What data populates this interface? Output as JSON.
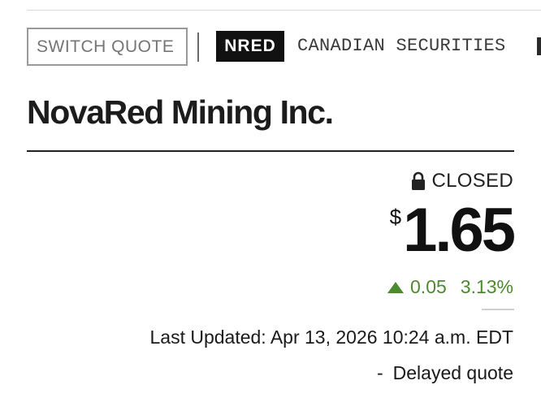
{
  "search": {
    "placeholder": "SWITCH QUOTE"
  },
  "quote": {
    "ticker": "NRED",
    "exchange": "CANADIAN SECURITIES",
    "company_name": "NovaRed Mining Inc.",
    "market_status": "CLOSED",
    "currency_symbol": "$",
    "price": "1.65",
    "change": "0.05",
    "change_percent": "3.13%",
    "change_direction": "up",
    "last_updated": "Last Updated: Apr 13, 2026 10:24 a.m. EDT",
    "delay_separator": "-",
    "delay_note": "Delayed quote"
  },
  "icons": {
    "status": "lock-icon",
    "change": "up-arrow-icon"
  },
  "colors": {
    "positive": "#4b8a2f",
    "badge_background": "#111111",
    "badge_text": "#ffffff"
  }
}
